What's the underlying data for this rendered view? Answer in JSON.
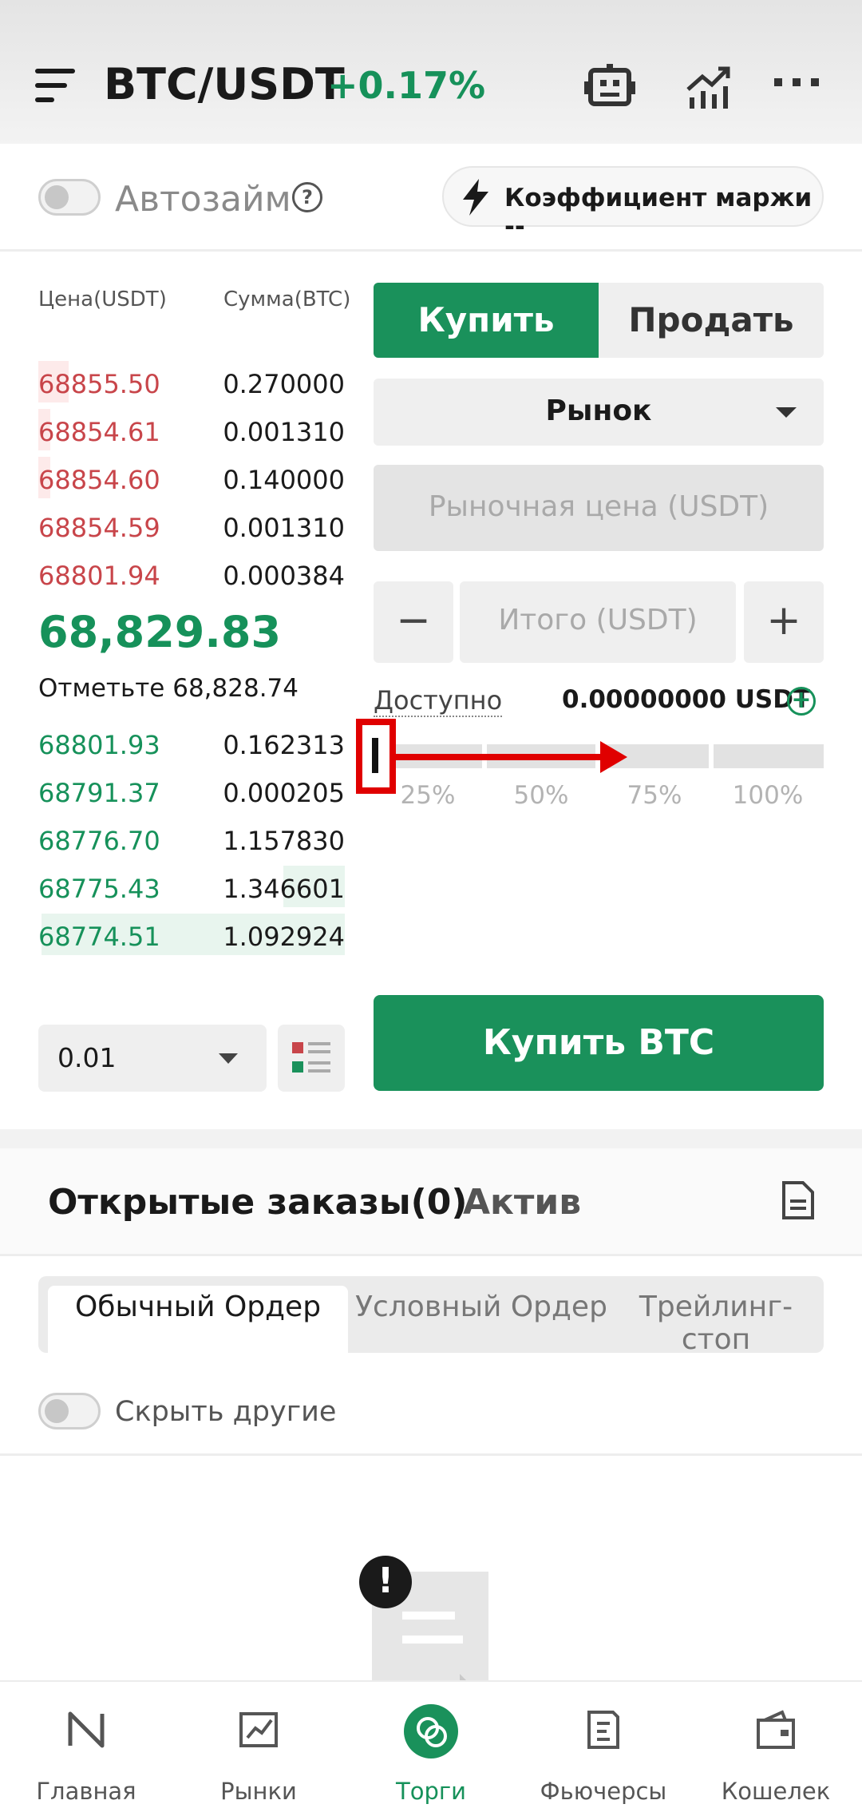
{
  "header": {
    "pair": "BTC/USDT",
    "change": "+0.17%"
  },
  "margin_bar": {
    "autoloan_label": "Автозайм",
    "help_glyph": "?",
    "margin_ratio_label": "Коэффициент маржи --"
  },
  "orderbook": {
    "price_header": "Цена(USDT)",
    "amount_header": "Сумма(BTC)",
    "asks": [
      {
        "price": "68855.50",
        "amount": "0.270000",
        "depth": 0.1
      },
      {
        "price": "68854.61",
        "amount": "0.001310",
        "depth": 0.04
      },
      {
        "price": "68854.60",
        "amount": "0.140000",
        "depth": 0.04
      },
      {
        "price": "68854.59",
        "amount": "0.001310",
        "depth": 0.0
      },
      {
        "price": "68801.94",
        "amount": "0.000384",
        "depth": 0.0
      }
    ],
    "last_price": "68,829.83",
    "mark_price": "Отметьте 68,828.74",
    "bids": [
      {
        "price": "68801.93",
        "amount": "0.162313",
        "depth": 0.0
      },
      {
        "price": "68791.37",
        "amount": "0.000205",
        "depth": 0.0
      },
      {
        "price": "68776.70",
        "amount": "1.157830",
        "depth": 0.0
      },
      {
        "price": "68775.43",
        "amount": "1.346601",
        "depth": 0.2
      },
      {
        "price": "68774.51",
        "amount": "1.092924",
        "depth": 0.99
      }
    ],
    "step": "0.01"
  },
  "trade": {
    "buy_tab": "Купить",
    "sell_tab": "Продать",
    "order_type": "Рынок",
    "price_placeholder": "Рыночная цена (USDT)",
    "minus": "−",
    "plus": "+",
    "total_placeholder": "Итого (USDT)",
    "available_label": "Доступно",
    "available_value": "0.00000000 USDT",
    "percent_labels": [
      "25%",
      "50%",
      "75%",
      "100%"
    ],
    "slider_value_percent": 0,
    "buy_button": "Купить BTC"
  },
  "orders": {
    "open_orders_tab": "Открытые заказы(0)",
    "assets_tab": "Актив",
    "subtabs": [
      "Обычный Ордер",
      "Условный Ордер",
      "Трейлинг-стоп"
    ],
    "hide_others": "Скрыть другие",
    "empty_alert_glyph": "!"
  },
  "nav": {
    "items": [
      "Главная",
      "Рынки",
      "Торги",
      "Фьючерсы",
      "Кошелек"
    ],
    "active": "Торги"
  },
  "colors": {
    "buy_green": "#1a915b",
    "ask_red": "#c8454a",
    "annotation_red": "#e00000"
  }
}
